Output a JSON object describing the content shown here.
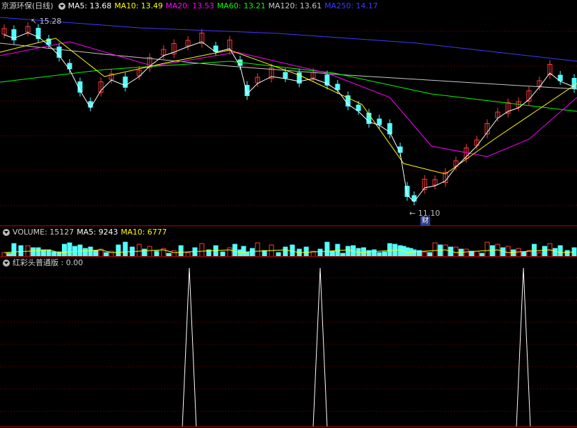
{
  "main": {
    "stock_title": "京源环保(日线)",
    "ma": [
      {
        "label": "MA5: 13.68",
        "color": "#ffffff"
      },
      {
        "label": "MA10: 13.49",
        "color": "#ffff00"
      },
      {
        "label": "MA20: 13.53",
        "color": "#ff00ff"
      },
      {
        "label": "MA60: 13.21",
        "color": "#00ff00"
      },
      {
        "label": "MA120: 13.61",
        "color": "#c8c8c8"
      },
      {
        "label": "MA250: 14.17",
        "color": "#3c3cff"
      }
    ],
    "high_label": "15.28",
    "low_label": "11.10",
    "event_badge": "财"
  },
  "volume": {
    "label": "VOLUME: 15127",
    "ma5": "MA5: 9243",
    "ma10": "MA10: 6777"
  },
  "indicator": {
    "label": "红彩头普通版 : 0.00"
  },
  "colors": {
    "up": "#ff3c3c",
    "down": "#54ffff",
    "grid": "#8a0000",
    "border": "#c00000"
  }
}
